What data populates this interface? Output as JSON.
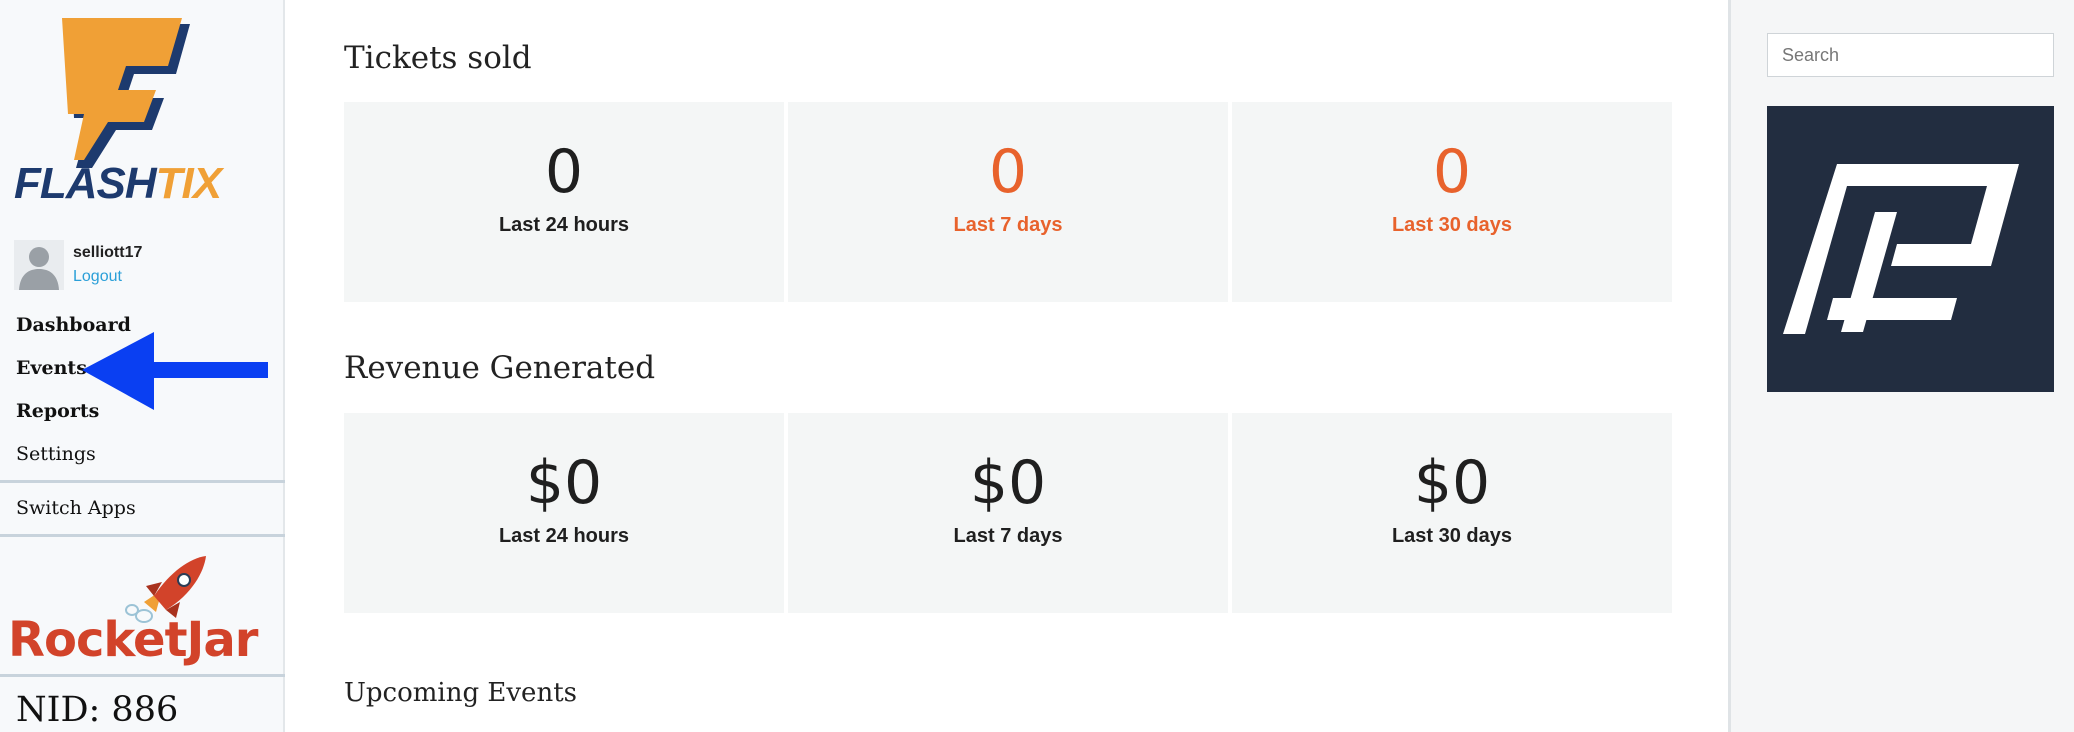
{
  "sidebar": {
    "logo_text_part1": "FLASH",
    "logo_text_part2": "TIX",
    "user": {
      "username": "selliott17",
      "logout_label": "Logout"
    },
    "nav": {
      "dashboard": "Dashboard",
      "events": "Events",
      "reports": "Reports",
      "settings": "Settings",
      "switch_apps": "Switch Apps"
    },
    "partner_logo_text": "RocketJar",
    "nid_label": "NID: 886",
    "colors": {
      "logo_orange": "#f0a036",
      "logo_navy": "#1d3a6e",
      "rocketjar_red": "#d2432a",
      "annotation_arrow": "#0a3ff2"
    }
  },
  "main": {
    "tickets": {
      "title": "Tickets sold",
      "cards": [
        {
          "value": "0",
          "label": "Last 24 hours"
        },
        {
          "value": "0",
          "label": "Last 7 days"
        },
        {
          "value": "0",
          "label": "Last 30 days"
        }
      ]
    },
    "revenue": {
      "title": "Revenue Generated",
      "cards": [
        {
          "value": "$0",
          "label": "Last 24 hours"
        },
        {
          "value": "$0",
          "label": "Last 7 days"
        },
        {
          "value": "$0",
          "label": "Last 30 days"
        }
      ]
    },
    "upcoming": {
      "title": "Upcoming Events"
    },
    "colors": {
      "accent_orange": "#e8622c"
    }
  },
  "right_panel": {
    "search_placeholder": "Search",
    "brand_bg": "#222d40"
  }
}
